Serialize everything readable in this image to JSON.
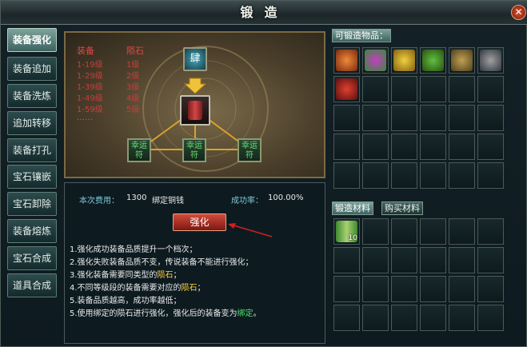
{
  "window": {
    "title": "锻造",
    "close": "✕"
  },
  "sidebar": {
    "items": [
      {
        "label": "装备强化",
        "active": true
      },
      {
        "label": "装备追加",
        "active": false
      },
      {
        "label": "装备洗炼",
        "active": false
      },
      {
        "label": "追加转移",
        "active": false
      },
      {
        "label": "装备打孔",
        "active": false
      },
      {
        "label": "宝石镶嵌",
        "active": false
      },
      {
        "label": "宝石卸除",
        "active": false
      },
      {
        "label": "装备熔炼",
        "active": false
      },
      {
        "label": "宝石合成",
        "active": false
      },
      {
        "label": "道具合成",
        "active": false
      }
    ]
  },
  "forge": {
    "table": {
      "header_equip": "装备",
      "header_stone": "陨石",
      "rows": [
        {
          "equip": "1-19级",
          "stone": "1级"
        },
        {
          "equip": "1-29级",
          "stone": "2级"
        },
        {
          "equip": "1-39级",
          "stone": "3级"
        },
        {
          "equip": "1-49级",
          "stone": "4级"
        },
        {
          "equip": "1-59级",
          "stone": "5级"
        }
      ],
      "more": "……"
    },
    "stone_slot_glyph": "肆",
    "lucky_label_1": "幸运符",
    "lucky_label_2": "幸运符",
    "lucky_label_3": "幸运符",
    "lucky_text": "幸运",
    "lucky_text2": "符"
  },
  "info": {
    "cost_label": "本次费用：",
    "cost_value": "1300",
    "cost_unit": "绑定铜钱",
    "rate_label": "成功率：",
    "rate_value": "100.00%",
    "button": "强化",
    "rules": [
      {
        "a": "1.强化成功装备品质提升一个档次；",
        "hl": "",
        "b": ""
      },
      {
        "a": "2.强化失败装备品质不变，传说装备不能进行强化；",
        "hl": "",
        "b": ""
      },
      {
        "a": "3.强化装备需要同类型的",
        "hl": "陨石",
        "b": "；"
      },
      {
        "a": "4.不同等级段的装备需要对应的",
        "hl": "陨石",
        "b": "；"
      },
      {
        "a": "5.装备品质越高，成功率越低；",
        "hl": "",
        "b": ""
      },
      {
        "a": "5.使用绑定的陨石进行强化，强化后的装备变为",
        "hl": "绑定",
        "b": "。"
      }
    ]
  },
  "right": {
    "forgeable_title": "可锻造物品：",
    "tab_materials": "锻造材料",
    "tab_buy": "购买材料",
    "item_count": "10",
    "colors": {
      "accent": "#7ea39a",
      "red_btn": "#d34a3c",
      "highlight": "#ffd23a",
      "green": "#4fe36a"
    }
  }
}
